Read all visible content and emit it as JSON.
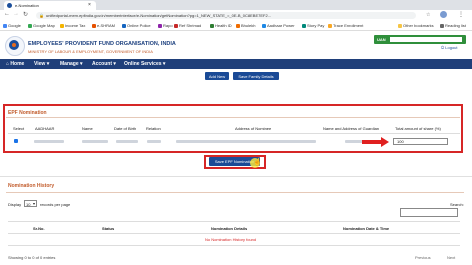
{
  "browser": {
    "tab_title": "e-Nomination",
    "url": "unifiedportal-mem.epfindia.gov.in/memberinterface/e-Nomination/getNomination?pg=1_NEW_STATE_=_0E-B_0C8EBE7EF2...",
    "bookmarks": [
      "Google",
      "Google Map",
      "Income Tax",
      "e-SHRAM",
      "Online Police",
      "Rapo",
      "Ref Shrimad",
      "Health ID",
      "Bhulekh",
      "Aadhaar Power",
      "Story Pay",
      "Trace Enrollment",
      "Other bookmarks",
      "Reading list"
    ],
    "colors": {
      "tabstrip": "#dee1e6",
      "address_bar": "#ffffff"
    }
  },
  "header": {
    "org_name": "EMPLOYEES' PROVIDENT FUND ORGANISATION, INDIA",
    "ministry": "MINISTRY OF LABOUR & EMPLOYMENT, GOVERNMENT OF INDIA",
    "uan_label": "UAN",
    "logout": "Logout",
    "icons": [
      "epfo-logo",
      "logout-icon"
    ]
  },
  "nav": {
    "items": [
      {
        "label": "Home",
        "icon": "home-icon"
      },
      {
        "label": "View",
        "suffix": "▾"
      },
      {
        "label": "Manage",
        "suffix": "▾"
      },
      {
        "label": "Account",
        "suffix": "▾"
      },
      {
        "label": "Online Services",
        "suffix": "▾"
      }
    ],
    "color": "#1f3f7a"
  },
  "family": {
    "add_new": "Add New",
    "save_family": "Save Family Details"
  },
  "epf": {
    "title": "EPF Nomination",
    "columns": [
      "Select",
      "AADHAAR",
      "Name",
      "Date of Birth",
      "Relation",
      "Address of Nominee",
      "Name and Address of Guardian",
      "Total amount of share (%)"
    ],
    "row": {
      "share": "100"
    },
    "save_button": "Save EPF Nomination",
    "highlight_color": "#d62626"
  },
  "history": {
    "title": "Nomination History",
    "display_label": "Display",
    "display_value": "10",
    "records_label": "records per page",
    "search_label": "Search:",
    "columns": [
      "Sr.No.",
      "Status",
      "Nomination Details",
      "Nomination Date & Time"
    ],
    "empty": "No Nomination History found",
    "info": "Showing 0 to 0 of 0 entries",
    "prev": "Previous",
    "next": "Next"
  }
}
